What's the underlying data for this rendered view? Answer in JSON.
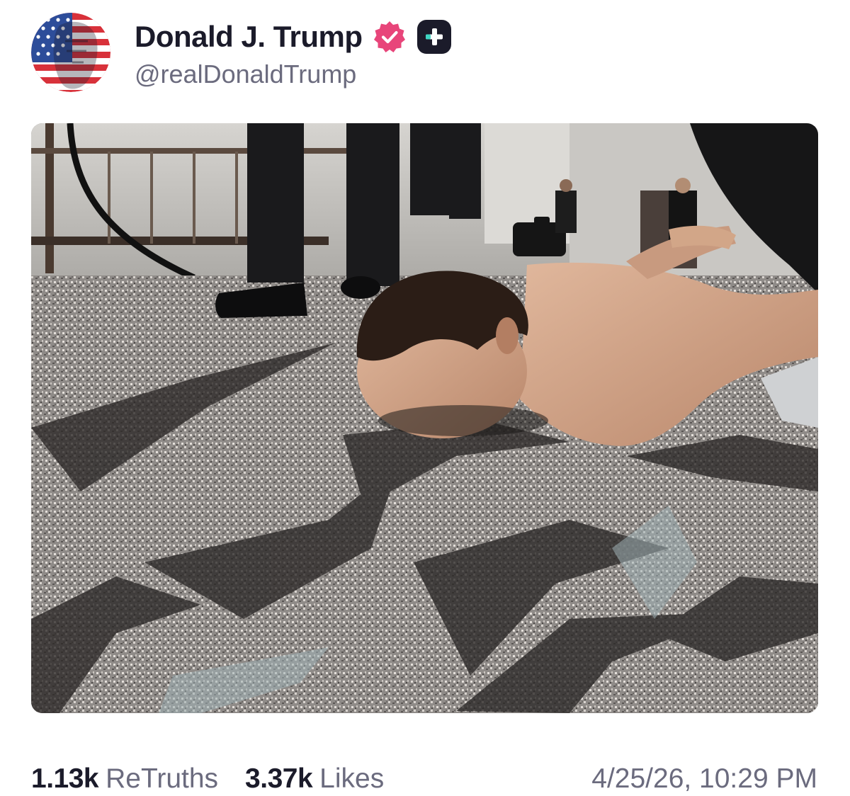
{
  "post": {
    "author": {
      "display_name": "Donald J. Trump",
      "handle": "@realDonaldTrump",
      "avatar_icon": "flag-portrait-avatar",
      "verified_icon": "verified-badge-icon",
      "verified_color": "#e8457a",
      "plus_icon": "plus-badge-icon"
    },
    "media": {
      "type": "photo"
    },
    "stats": {
      "retruths_count": "1.13k",
      "retruths_label": "ReTruths",
      "likes_count": "3.37k",
      "likes_label": "Likes"
    },
    "timestamp": "4/25/26, 10:29 PM"
  },
  "colors": {
    "text_primary": "#1b1b2a",
    "text_secondary": "#6b6b7e"
  }
}
